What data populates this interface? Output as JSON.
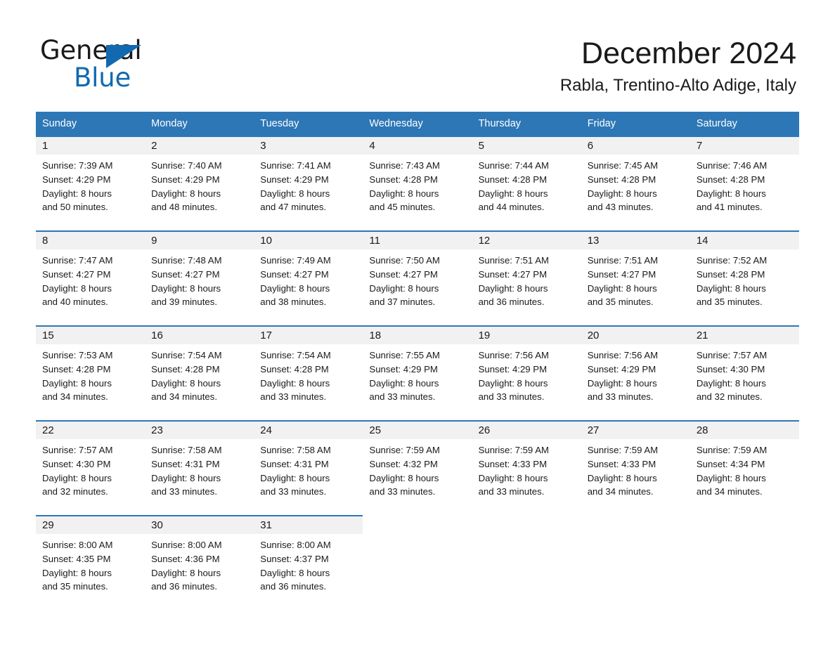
{
  "brand": {
    "line1": "General",
    "line2": "Blue",
    "triangle_color": "#1269b0",
    "logo_icon": "general-blue-logo"
  },
  "header": {
    "month_title": "December 2024",
    "location": "Rabla, Trentino-Alto Adige, Italy"
  },
  "theme": {
    "header_blue": "#2e77b6",
    "row_divider_blue": "#2e77b6",
    "daynum_band": "#f1f1f1",
    "text": "#1a1a1a",
    "page_background": "#ffffff"
  },
  "weekday_headers": [
    "Sunday",
    "Monday",
    "Tuesday",
    "Wednesday",
    "Thursday",
    "Friday",
    "Saturday"
  ],
  "weeks": [
    [
      {
        "day": "1",
        "info": "Sunrise: 7:39 AM\nSunset: 4:29 PM\nDaylight: 8 hours\nand 50 minutes."
      },
      {
        "day": "2",
        "info": "Sunrise: 7:40 AM\nSunset: 4:29 PM\nDaylight: 8 hours\nand 48 minutes."
      },
      {
        "day": "3",
        "info": "Sunrise: 7:41 AM\nSunset: 4:29 PM\nDaylight: 8 hours\nand 47 minutes."
      },
      {
        "day": "4",
        "info": "Sunrise: 7:43 AM\nSunset: 4:28 PM\nDaylight: 8 hours\nand 45 minutes."
      },
      {
        "day": "5",
        "info": "Sunrise: 7:44 AM\nSunset: 4:28 PM\nDaylight: 8 hours\nand 44 minutes."
      },
      {
        "day": "6",
        "info": "Sunrise: 7:45 AM\nSunset: 4:28 PM\nDaylight: 8 hours\nand 43 minutes."
      },
      {
        "day": "7",
        "info": "Sunrise: 7:46 AM\nSunset: 4:28 PM\nDaylight: 8 hours\nand 41 minutes."
      }
    ],
    [
      {
        "day": "8",
        "info": "Sunrise: 7:47 AM\nSunset: 4:27 PM\nDaylight: 8 hours\nand 40 minutes."
      },
      {
        "day": "9",
        "info": "Sunrise: 7:48 AM\nSunset: 4:27 PM\nDaylight: 8 hours\nand 39 minutes."
      },
      {
        "day": "10",
        "info": "Sunrise: 7:49 AM\nSunset: 4:27 PM\nDaylight: 8 hours\nand 38 minutes."
      },
      {
        "day": "11",
        "info": "Sunrise: 7:50 AM\nSunset: 4:27 PM\nDaylight: 8 hours\nand 37 minutes."
      },
      {
        "day": "12",
        "info": "Sunrise: 7:51 AM\nSunset: 4:27 PM\nDaylight: 8 hours\nand 36 minutes."
      },
      {
        "day": "13",
        "info": "Sunrise: 7:51 AM\nSunset: 4:27 PM\nDaylight: 8 hours\nand 35 minutes."
      },
      {
        "day": "14",
        "info": "Sunrise: 7:52 AM\nSunset: 4:28 PM\nDaylight: 8 hours\nand 35 minutes."
      }
    ],
    [
      {
        "day": "15",
        "info": "Sunrise: 7:53 AM\nSunset: 4:28 PM\nDaylight: 8 hours\nand 34 minutes."
      },
      {
        "day": "16",
        "info": "Sunrise: 7:54 AM\nSunset: 4:28 PM\nDaylight: 8 hours\nand 34 minutes."
      },
      {
        "day": "17",
        "info": "Sunrise: 7:54 AM\nSunset: 4:28 PM\nDaylight: 8 hours\nand 33 minutes."
      },
      {
        "day": "18",
        "info": "Sunrise: 7:55 AM\nSunset: 4:29 PM\nDaylight: 8 hours\nand 33 minutes."
      },
      {
        "day": "19",
        "info": "Sunrise: 7:56 AM\nSunset: 4:29 PM\nDaylight: 8 hours\nand 33 minutes."
      },
      {
        "day": "20",
        "info": "Sunrise: 7:56 AM\nSunset: 4:29 PM\nDaylight: 8 hours\nand 33 minutes."
      },
      {
        "day": "21",
        "info": "Sunrise: 7:57 AM\nSunset: 4:30 PM\nDaylight: 8 hours\nand 32 minutes."
      }
    ],
    [
      {
        "day": "22",
        "info": "Sunrise: 7:57 AM\nSunset: 4:30 PM\nDaylight: 8 hours\nand 32 minutes."
      },
      {
        "day": "23",
        "info": "Sunrise: 7:58 AM\nSunset: 4:31 PM\nDaylight: 8 hours\nand 33 minutes."
      },
      {
        "day": "24",
        "info": "Sunrise: 7:58 AM\nSunset: 4:31 PM\nDaylight: 8 hours\nand 33 minutes."
      },
      {
        "day": "25",
        "info": "Sunrise: 7:59 AM\nSunset: 4:32 PM\nDaylight: 8 hours\nand 33 minutes."
      },
      {
        "day": "26",
        "info": "Sunrise: 7:59 AM\nSunset: 4:33 PM\nDaylight: 8 hours\nand 33 minutes."
      },
      {
        "day": "27",
        "info": "Sunrise: 7:59 AM\nSunset: 4:33 PM\nDaylight: 8 hours\nand 34 minutes."
      },
      {
        "day": "28",
        "info": "Sunrise: 7:59 AM\nSunset: 4:34 PM\nDaylight: 8 hours\nand 34 minutes."
      }
    ],
    [
      {
        "day": "29",
        "info": "Sunrise: 8:00 AM\nSunset: 4:35 PM\nDaylight: 8 hours\nand 35 minutes."
      },
      {
        "day": "30",
        "info": "Sunrise: 8:00 AM\nSunset: 4:36 PM\nDaylight: 8 hours\nand 36 minutes."
      },
      {
        "day": "31",
        "info": "Sunrise: 8:00 AM\nSunset: 4:37 PM\nDaylight: 8 hours\nand 36 minutes."
      },
      {
        "day": "",
        "info": ""
      },
      {
        "day": "",
        "info": ""
      },
      {
        "day": "",
        "info": ""
      },
      {
        "day": "",
        "info": ""
      }
    ]
  ]
}
